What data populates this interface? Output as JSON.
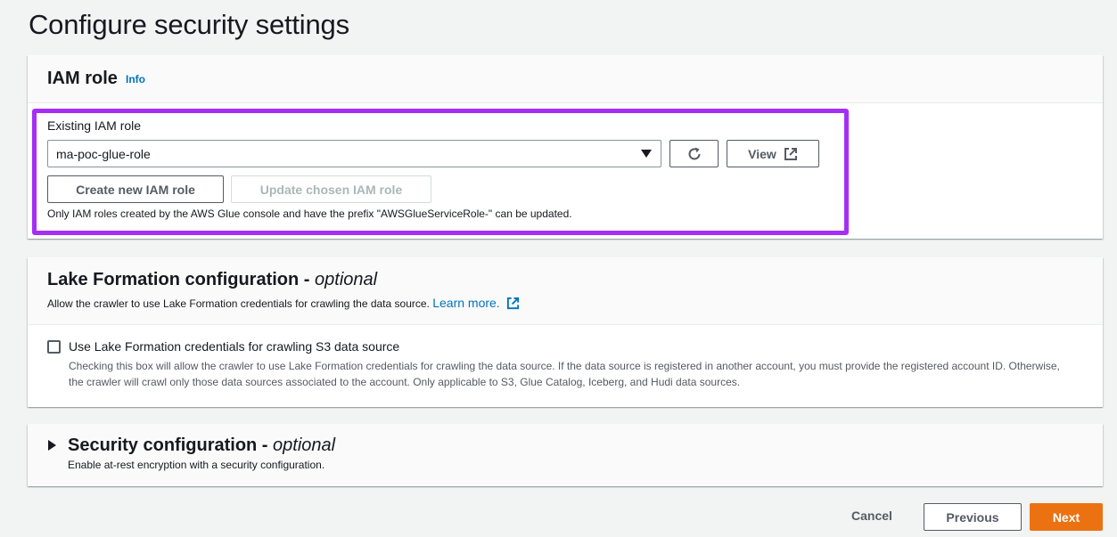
{
  "page": {
    "title": "Configure security settings"
  },
  "iam": {
    "title": "IAM role",
    "info": "Info",
    "field_label": "Existing IAM role",
    "selected_role": "ma-poc-glue-role",
    "view_label": "View",
    "create_label": "Create new IAM role",
    "update_label": "Update chosen IAM role",
    "hint": "Only IAM roles created by the AWS Glue console and have the prefix \"AWSGlueServiceRole-\" can be updated."
  },
  "lake_formation": {
    "title": "Lake Formation configuration -",
    "optional": "optional",
    "description": "Allow the crawler to use Lake Formation credentials for crawling the data source.",
    "learn_more": "Learn more.",
    "checkbox_label": "Use Lake Formation credentials for crawling S3 data source",
    "checkbox_checked": false,
    "checkbox_description": "Checking this box will allow the crawler to use Lake Formation credentials for crawling the data source. If the data source is registered in another account, you must provide the registered account ID. Otherwise, the crawler will crawl only those data sources associated to the account. Only applicable to S3, Glue Catalog, Iceberg, and Hudi data sources."
  },
  "security_config": {
    "title": "Security configuration -",
    "optional": "optional",
    "description": "Enable at-rest encryption with a security configuration."
  },
  "footer": {
    "cancel": "Cancel",
    "previous": "Previous",
    "next": "Next"
  },
  "colors": {
    "highlight": "#a52ff5",
    "link": "#0073bb",
    "primary": "#ec7211"
  },
  "icons": [
    "caret-down-icon",
    "refresh-icon",
    "external-link-icon",
    "expand-triangle-icon"
  ]
}
